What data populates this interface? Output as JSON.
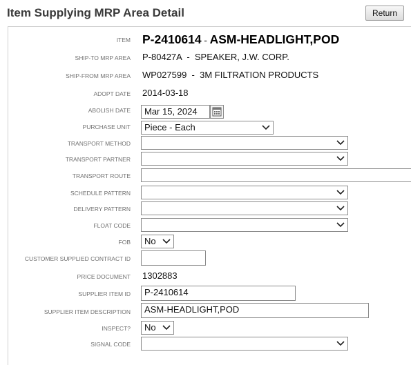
{
  "header": {
    "title": "Item Supplying MRP Area Detail",
    "return_label": "Return"
  },
  "item": {
    "label": "ITEM",
    "number": "P-2410614",
    "sep": "-",
    "description": "ASM-HEADLIGHT,POD"
  },
  "ship_to": {
    "label": "SHIP-TO MRP AREA",
    "value": "P-80427A  -  SPEAKER, J.W. CORP."
  },
  "ship_from": {
    "label": "SHIP-FROM MRP AREA",
    "value": "WP027599  -  3M FILTRATION PRODUCTS"
  },
  "adopt_date": {
    "label": "ADOPT DATE",
    "value": "2014-03-18"
  },
  "abolish_date": {
    "label": "ABOLISH DATE",
    "value": "Mar 15, 2024"
  },
  "purchase_unit": {
    "label": "PURCHASE UNIT",
    "value": "Piece - Each"
  },
  "transport_method": {
    "label": "TRANSPORT METHOD",
    "value": ""
  },
  "transport_partner": {
    "label": "TRANSPORT PARTNER",
    "value": ""
  },
  "transport_route": {
    "label": "TRANSPORT ROUTE",
    "value": ""
  },
  "schedule_pattern": {
    "label": "SCHEDULE PATTERN",
    "value": ""
  },
  "delivery_pattern": {
    "label": "DELIVERY PATTERN",
    "value": ""
  },
  "float_code": {
    "label": "FLOAT CODE",
    "value": ""
  },
  "fob": {
    "label": "FOB",
    "value": "No"
  },
  "customer_contract": {
    "label": "CUSTOMER SUPPLIED CONTRACT ID",
    "value": ""
  },
  "price_document": {
    "label": "PRICE DOCUMENT",
    "value": "1302883"
  },
  "supplier_item_id": {
    "label": "SUPPLIER ITEM ID",
    "value": "P-2410614"
  },
  "supplier_item_description": {
    "label": "SUPPLIER ITEM DESCRIPTION",
    "value": "ASM-HEADLIGHT,POD"
  },
  "inspect": {
    "label": "INSPECT?",
    "value": "No"
  },
  "signal_code": {
    "label": "SIGNAL CODE",
    "value": ""
  }
}
